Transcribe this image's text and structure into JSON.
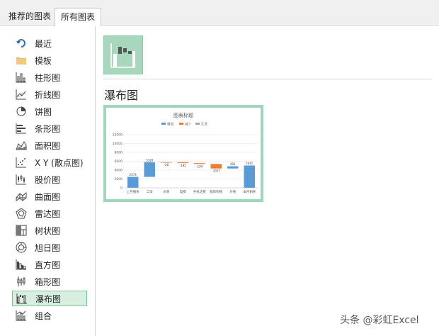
{
  "tabs": [
    {
      "label": "推荐的图表"
    },
    {
      "label": "所有图表"
    }
  ],
  "sidebar": {
    "items": [
      {
        "label": "最近",
        "icon": "recent-icon"
      },
      {
        "label": "模板",
        "icon": "folder-icon"
      },
      {
        "label": "柱形图",
        "icon": "column-chart-icon"
      },
      {
        "label": "折线图",
        "icon": "line-chart-icon"
      },
      {
        "label": "饼图",
        "icon": "pie-chart-icon"
      },
      {
        "label": "条形图",
        "icon": "bar-chart-icon"
      },
      {
        "label": "面积图",
        "icon": "area-chart-icon"
      },
      {
        "label": "X Y (散点图)",
        "icon": "scatter-chart-icon"
      },
      {
        "label": "股价图",
        "icon": "stock-chart-icon"
      },
      {
        "label": "曲面图",
        "icon": "surface-chart-icon"
      },
      {
        "label": "雷达图",
        "icon": "radar-chart-icon"
      },
      {
        "label": "树状图",
        "icon": "treemap-chart-icon"
      },
      {
        "label": "旭日图",
        "icon": "sunburst-chart-icon"
      },
      {
        "label": "直方图",
        "icon": "histogram-chart-icon"
      },
      {
        "label": "箱形图",
        "icon": "box-whisker-chart-icon"
      },
      {
        "label": "瀑布图",
        "icon": "waterfall-chart-icon",
        "selected": true
      },
      {
        "label": "组合",
        "icon": "combo-chart-icon"
      }
    ]
  },
  "main": {
    "heading": "瀑布图"
  },
  "watermark": "头条 @彩虹Excel",
  "colors": {
    "increase": "#5b9bd5",
    "decrease": "#ed7d31",
    "total": "#a5a5a5",
    "accent": "#a7d7bd"
  },
  "chart_data": {
    "type": "waterfall",
    "title": "图表标题",
    "legend": [
      "增加",
      "减少",
      "汇总"
    ],
    "legend_position": "top",
    "categories": [
      "上月剩余",
      "工资",
      "水费",
      "电费",
      "手机话费",
      "服饰购物",
      "外快",
      "本月剩余"
    ],
    "values": [
      2474,
      3320,
      -28,
      -185,
      -194,
      -1017,
      491,
      5041
    ],
    "labels": [
      "2474",
      "3320",
      "-28",
      "-185",
      "-194",
      "-1017",
      "491",
      "5041"
    ],
    "kinds": [
      "increase",
      "increase",
      "decrease",
      "decrease",
      "decrease",
      "decrease",
      "increase",
      "increase"
    ],
    "ylim": [
      0,
      12000
    ],
    "yticks": [
      "0",
      "2000",
      "4000",
      "6000",
      "8000",
      "10000",
      "12000"
    ],
    "grid": true
  }
}
